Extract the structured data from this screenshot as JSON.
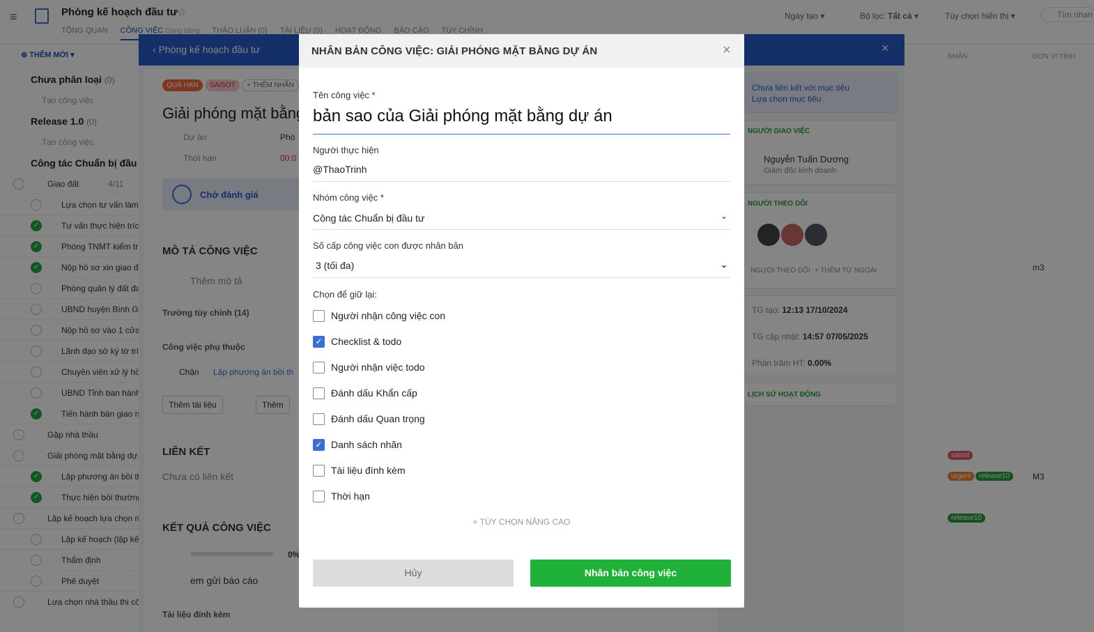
{
  "topbar": {
    "title": "Phòng kế hoạch đầu tư",
    "tabs": [
      "TỔNG QUAN",
      "CÔNG VIỆC",
      "Dạng bảng",
      "THẢO LUẬN (0)",
      "TÀI LIỆU (0)",
      "HOẠT ĐỘNG",
      "BÁO CÁO",
      "TÙY CHỈNH"
    ],
    "sort_label": "Ngày tạo",
    "filter_label": "Bộ lọc:",
    "filter_value": "Tất cả",
    "display_label": "Tùy chọn hiển thị",
    "search_placeholder": "Tìm nhan"
  },
  "left": {
    "add_new": "THÊM MỚI",
    "groups": [
      {
        "name": "Chưa phân loại",
        "count": "(0)",
        "create": "Tạo công việc"
      },
      {
        "name": "Release 1.0",
        "count": "(0)",
        "create": "Tạo công việc"
      },
      {
        "name": "Công tác Chuẩn bị đầu"
      }
    ],
    "rows": [
      {
        "text": "Giao đất",
        "sub": "4/11",
        "done": false
      },
      {
        "text": "Lựa chọn tư vấn làm",
        "done": false
      },
      {
        "text": "Tư vấn thực hiện trích",
        "done": true
      },
      {
        "text": "Phòng TNMT kiểm tr",
        "done": true
      },
      {
        "text": "Nộp hồ sơ xin giao đ",
        "done": true
      },
      {
        "text": "Phòng quản lý đất đa",
        "done": false
      },
      {
        "text": "UBND huyện Bình Gia",
        "done": false
      },
      {
        "text": "Nộp hồ sơ vào 1 cửa,",
        "done": false
      },
      {
        "text": "Lãnh đạo sở ký tờ trì",
        "done": false
      },
      {
        "text": "Chuyên viên xử lý hồ",
        "done": false
      },
      {
        "text": "UBND Tỉnh ban hành",
        "done": false
      },
      {
        "text": "Tiến hành bàn giao n",
        "done": true
      },
      {
        "text": "Gặp nhà thầu",
        "done": false
      },
      {
        "text": "Giải phóng mặt bằng dự",
        "done": false
      },
      {
        "text": "Lập phương án bồi th",
        "done": true
      },
      {
        "text": "Thực hiện bồi thường",
        "done": true
      },
      {
        "text": "Lập kế hoạch lựa chọn n",
        "done": false
      },
      {
        "text": "Lập kế hoạch (lập kế",
        "done": false
      },
      {
        "text": "Thẩm định",
        "done": false
      },
      {
        "text": "Phê duyệt",
        "done": false
      },
      {
        "text": "Lựa chọn nhà thầu thi cô",
        "done": false
      }
    ]
  },
  "right": {
    "col_nhan": "NHÃN",
    "col_donvi": "ĐƠN VỊ TÍNH",
    "unit_m3": "m3",
    "unit_M3": "M3",
    "tags": {
      "saisot": "saisot",
      "urgent": "urgent",
      "release10": "release10"
    }
  },
  "detail": {
    "back_label": "Phòng kế hoạch đầu tư",
    "badge_overdue": "QUÁ HẠN",
    "badge_saisot": "SAISOT",
    "add_tag": "+ THÊM NHÃN",
    "title": "Giải phóng mặt bằng",
    "project_label": "Dự án",
    "project_value": "Phò",
    "deadline_label": "Thời hạn",
    "deadline_value": "00:0",
    "status": "Chờ đánh giá",
    "desc_header": "MÔ TẢ CÔNG VIỆC",
    "add_desc": "Thêm mô tả",
    "custom_fields": "Trường tùy chỉnh (14)",
    "dependency": "Công việc phụ thuộc",
    "block": "Chặn",
    "block_link": "Lập phương án bồi th",
    "add_doc": "Thêm tài liệu",
    "add_more": "Thêm",
    "link_header": "LIÊN KẾT",
    "no_link": "Chưa có liên kết",
    "result_header": "KẾT QUẢ CÔNG VIỆC",
    "progress": "0%",
    "report": "em gửi báo cáo",
    "attachments": "Tài liệu đính kèm",
    "goal_unlinked": "Chưa liên kết với mục tiêu",
    "goal_select": "Lựa chọn mục tiêu",
    "assigner_header": "NGƯỜI GIAO VIỆC",
    "assigner_name": "Nguyễn Tuấn Dương",
    "assigner_role": "Giám đốc kinh doanh",
    "followers_header": "NGƯỜI THEO DÕI",
    "followers_btn": "NGƯỜI THEO DÕI",
    "add_external": "THÊM TỪ NGOÀI",
    "created_label": "TG tạo:",
    "created_value": "12:13 17/10/2024",
    "updated_label": "TG cập nhật:",
    "updated_value": "14:57 07/05/2025",
    "percent_label": "Phần trăm HT:",
    "percent_value": "0.00%",
    "history_header": "LỊCH SỬ HOẠT ĐỘNG"
  },
  "modal": {
    "title": "NHÂN BẢN CÔNG VIỆC: GIẢI PHÓNG MẶT BẰNG DỰ ÁN",
    "name_label": "Tên công việc *",
    "name_value": "bản sao của Giải phóng mặt bằng dự án",
    "assignee_label": "Người thực hiện",
    "assignee_value": "@ThaoTrinh",
    "group_label": "Nhóm công việc *",
    "group_value": "Công tác Chuẩn bị đầu tư",
    "levels_label": "Số cấp công việc con được nhân bản",
    "levels_value": "3 (tối đa)",
    "keep_label": "Chọn để giữ lại:",
    "options": [
      {
        "label": "Người nhận công việc con",
        "checked": false
      },
      {
        "label": "Checklist & todo",
        "checked": true
      },
      {
        "label": "Người nhận việc todo",
        "checked": false
      },
      {
        "label": "Đánh dấu Khẩn cấp",
        "checked": false
      },
      {
        "label": "Đánh dấu Quan trọng",
        "checked": false
      },
      {
        "label": "Danh sách nhãn",
        "checked": true
      },
      {
        "label": "Tài liệu đính kèm",
        "checked": false
      },
      {
        "label": "Thời hạn",
        "checked": false
      }
    ],
    "advanced": "+ TÙY CHỌN NÂNG CAO",
    "cancel": "Hủy",
    "confirm": "Nhân bản công việc"
  }
}
